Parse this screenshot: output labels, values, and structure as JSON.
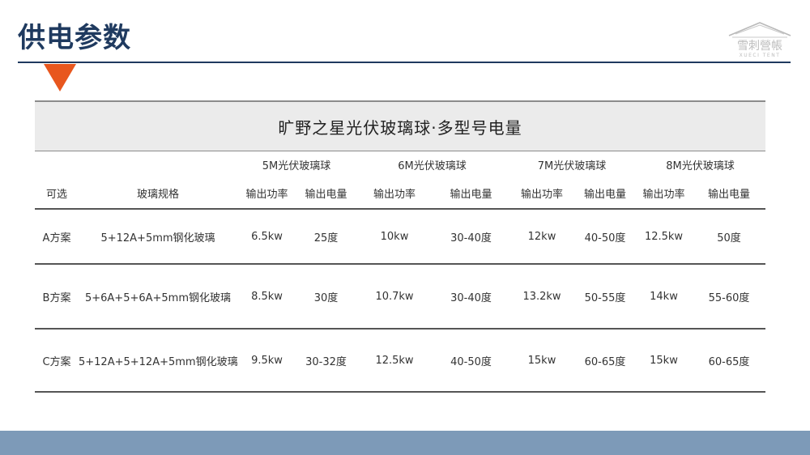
{
  "page": {
    "title": "供电参数"
  },
  "logo": {
    "mark": "雪刺營帳",
    "sub": "XUECI TENT"
  },
  "table": {
    "caption": "旷野之星光伏玻璃球·多型号电量",
    "groups": [
      "5M光伏玻璃球",
      "6M光伏玻璃球",
      "7M光伏玻璃球",
      "8M光伏玻璃球"
    ],
    "headers": [
      "可选",
      "玻璃规格",
      "输出功率",
      "输出电量",
      "输出功率",
      "输出电量",
      "输出功率",
      "输出电量",
      "输出功率",
      "输出电量"
    ],
    "rows": [
      [
        "A方案",
        "5+12A+5mm钢化玻璃",
        "6.5kw",
        "25度",
        "10kw",
        "30-40度",
        "12kw",
        "40-50度",
        "12.5kw",
        "50度"
      ],
      [
        "B方案",
        "5+6A+5+6A+5mm钢化玻璃",
        "8.5kw",
        "30度",
        "10.7kw",
        "30-40度",
        "13.2kw",
        "50-55度",
        "14kw",
        "55-60度"
      ],
      [
        "C方案",
        "5+12A+5+12A+5mm钢化玻璃",
        "9.5kw",
        "30-32度",
        "12.5kw",
        "40-50度",
        "15kw",
        "60-65度",
        "15kw",
        "60-65度"
      ]
    ]
  },
  "colors": {
    "title": "#1f3a5f",
    "accent_triangle": "#e8571e",
    "caption_bg": "#ebebeb",
    "bottom_band": "#7d9ab8"
  }
}
